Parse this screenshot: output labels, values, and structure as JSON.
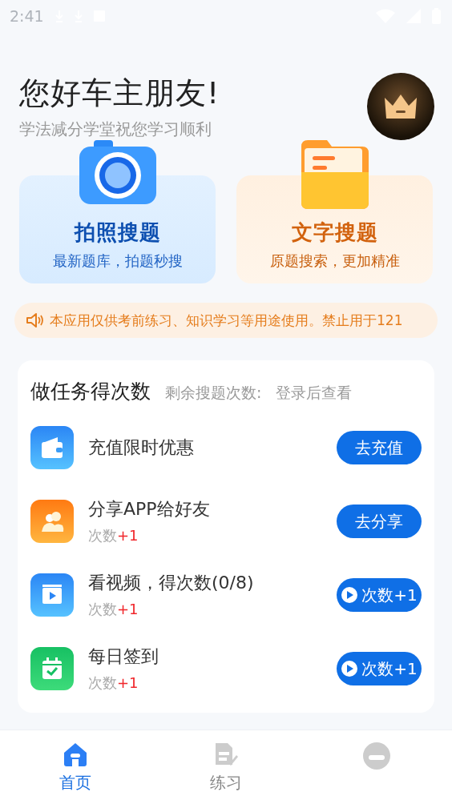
{
  "status_bar": {
    "time": "2:41"
  },
  "header": {
    "greeting": "您好车主朋友!",
    "subtitle": "学法减分学堂祝您学习顺利"
  },
  "search_cards": [
    {
      "kind": "photo",
      "title": "拍照搜题",
      "subtitle": "最新题库，拍题秒搜"
    },
    {
      "kind": "text",
      "title": "文字搜题",
      "subtitle": "原题搜索，更加精准"
    }
  ],
  "notice": {
    "text": "本应用仅供考前练习、知识学习等用途使用。禁止用于121"
  },
  "tasks": {
    "title": "做任务得次数",
    "remaining_label": "剩余搜题次数:",
    "remaining_value": "登录后查看",
    "items": [
      {
        "kind": "wallet",
        "title": "充值限时优惠",
        "button": {
          "kind": "text",
          "label": "去充值"
        }
      },
      {
        "kind": "share",
        "title": "分享APP给好友",
        "reward_label": "次数",
        "reward": "+1",
        "button": {
          "kind": "text",
          "label": "去分享"
        }
      },
      {
        "kind": "video",
        "title": "看视频，得次数(0/8)",
        "reward_label": "次数",
        "reward": "+1",
        "button": {
          "kind": "play",
          "label": "次数+1"
        }
      },
      {
        "kind": "checkin",
        "title": "每日签到",
        "reward_label": "次数",
        "reward": "+1",
        "button": {
          "kind": "play",
          "label": "次数+1"
        }
      }
    ]
  },
  "tab_bar": [
    {
      "kind": "home",
      "label": "首页",
      "selected": true
    },
    {
      "kind": "practice",
      "label": "练习",
      "selected": false
    },
    {
      "kind": "profile",
      "selected": false
    }
  ]
}
